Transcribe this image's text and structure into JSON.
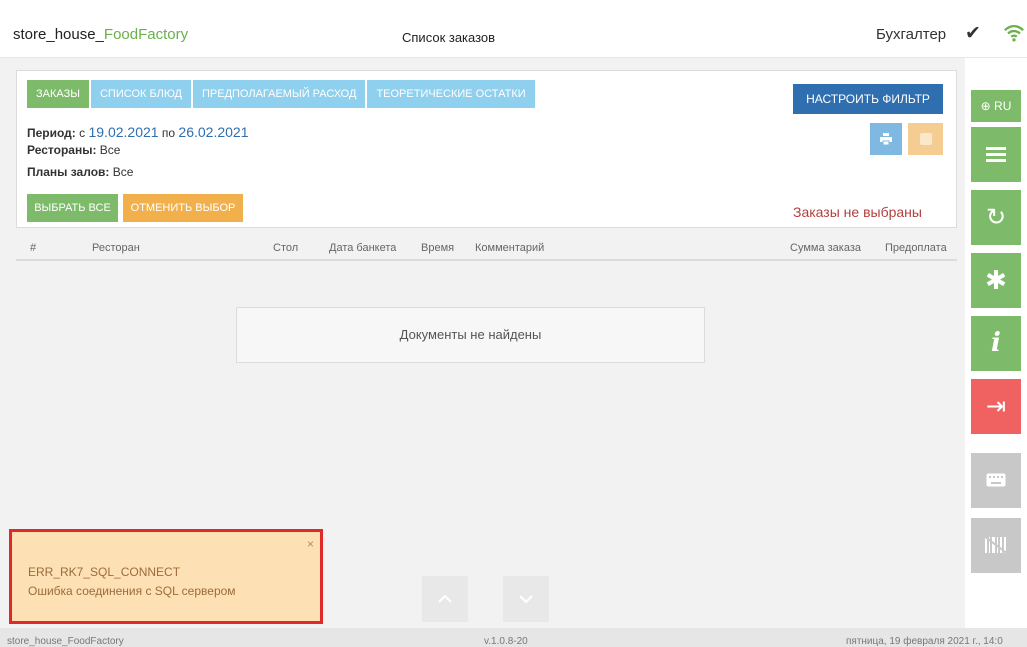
{
  "header": {
    "app_title_prefix": "store_house_",
    "app_title_accent": "FoodFactory",
    "page_title": "Список заказов",
    "user_role": "Бухгалтер",
    "check": "✔"
  },
  "tabs": [
    {
      "label": "Заказы"
    },
    {
      "label": "Список блюд"
    },
    {
      "label": "Предполагаемый расход"
    },
    {
      "label": "Теоретические остатки"
    }
  ],
  "filter": {
    "configure_label": "Настроить фильтр",
    "period_label": "Период:",
    "period_from_word": "с",
    "period_from": "19.02.2021",
    "period_to_word": "по",
    "period_to": "26.02.2021",
    "restaurants_label": "Рестораны:",
    "restaurants_value": "Все",
    "halls_label": "Планы залов:",
    "halls_value": "Все",
    "select_all_label": "Выбрать все",
    "cancel_select_label": "Отменить выбор",
    "no_orders_text": "Заказы не выбраны"
  },
  "table": {
    "columns": [
      "#",
      "Ресторан",
      "Стол",
      "Дата банкета",
      "Время",
      "Комментарий",
      "Сумма заказа",
      "Предоплата"
    ],
    "empty_text": "Документы не найдены"
  },
  "toast": {
    "close": "×",
    "code": "ERR_RK7_SQL_CONNECT",
    "message": "Ошибка соединения с SQL сервером"
  },
  "sidebar": {
    "lang": "RU",
    "sync": "↻",
    "settings": "✱",
    "info": "i",
    "logout": "⇥"
  },
  "footer": {
    "left": "store_house_FoodFactory",
    "version": "v.1.0.8-20",
    "datetime": "пятница, 19 февраля 2021 г., 14:0"
  },
  "colors": {
    "green": "#7dbb6a",
    "light_blue": "#8fd0ee",
    "dark_blue": "#2f6fb0",
    "orange": "#f1b04c",
    "red": "#f06262",
    "toast_border": "#e02a2a"
  }
}
